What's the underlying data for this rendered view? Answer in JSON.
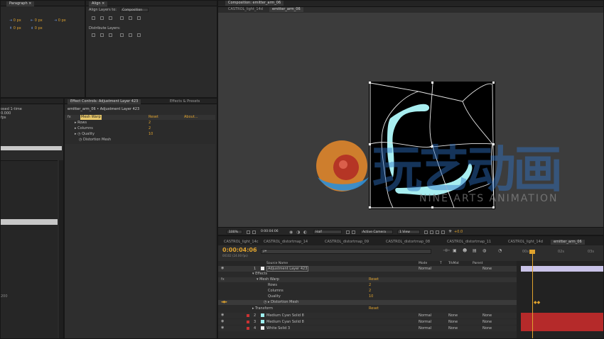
{
  "top_panels": {
    "paragraph_tab": "Paragraph ×",
    "align_tab": "Align ×",
    "align_layers_to_label": "Align Layers to:",
    "align_layers_to_value": "Composition",
    "distribute_layers_label": "Distribute Layers:",
    "paragraph_values": [
      "0 px",
      "0 px",
      "0 px",
      "0 px",
      "0 px"
    ]
  },
  "composition_panel": {
    "title": "Composition: emitter_arm_06",
    "tabs": [
      "CASTROL_light_14d",
      "emitter_arm_06"
    ],
    "footer": {
      "zoom": "100%",
      "timecode": "0:00:04:06",
      "resolution": "Half",
      "camera": "Active Camera",
      "views": "1 View",
      "exposure": "+0.0"
    }
  },
  "left_panel": {
    "info_lines": [
      "osed 1-time",
      "0.000",
      "fps"
    ],
    "bottom_value": "200"
  },
  "effect_controls": {
    "tab_label": "Effect Controls: Adjustment Layer 423",
    "tab2_label": "Effects & Presets",
    "breadcrumb": "emitter_arm_06 • Adjustment Layer 423",
    "effect_name": "Mesh Warp",
    "reset": "Reset",
    "about": "About...",
    "props": [
      {
        "name": "Rows",
        "value": "2"
      },
      {
        "name": "Columns",
        "value": "2"
      },
      {
        "name": "Quality",
        "value": "10"
      },
      {
        "name": "Distortion Mesh",
        "value": ""
      }
    ]
  },
  "timeline": {
    "tabs": [
      "CASTROL_light_14c",
      "CASTROL_distortmap_14",
      "CASTROL_distortmap_09",
      "CASTROL_distortmap_08",
      "CASTROL_distortmap_11",
      "CASTROL_light_14d",
      "emitter_arm_06"
    ],
    "timecode": "0:00:04:06",
    "fps_info": "00102 (24.00 fps)",
    "search_placeholder": "ρ▾",
    "columns": {
      "source_name": "Source Name",
      "mode": "Mode",
      "t": "T",
      "trkmat": "TrkMat",
      "parent": "Parent"
    },
    "ruler": [
      "00s",
      "02s",
      "03s",
      "04s"
    ],
    "layers": [
      {
        "num": "1",
        "name": "Adjustment Layer 423",
        "mode": "Normal",
        "trkmat": "",
        "parent": "None",
        "swatch": "white"
      },
      {
        "num": "2",
        "name": "Medium Cyan Solid 8",
        "mode": "Normal",
        "trkmat": "None",
        "parent": "None",
        "swatch": "cyan"
      },
      {
        "num": "3",
        "name": "Medium Cyan Solid 8",
        "mode": "Normal",
        "trkmat": "None",
        "parent": "None",
        "swatch": "cyan"
      },
      {
        "num": "4",
        "name": "White Solid 3",
        "mode": "Normal",
        "trkmat": "None",
        "parent": "None",
        "swatch": "white"
      }
    ],
    "sub_rows": [
      {
        "label": "Effects",
        "value": ""
      },
      {
        "label": "Mesh Warp",
        "value": "Reset"
      },
      {
        "label": "Rows",
        "value": "2"
      },
      {
        "label": "Columns",
        "value": "2"
      },
      {
        "label": "Quality",
        "value": "10"
      },
      {
        "label": "Distortion Mesh",
        "value": ""
      },
      {
        "label": "Transform",
        "value": "Reset"
      }
    ]
  },
  "watermark": {
    "cn_text": "玩艺动画",
    "en_text": "NINE ARTS ANIMATION"
  },
  "colors": {
    "accent_orange": "#e0a32e",
    "cyan_solid": "#9ff0f0",
    "track_red": "#b52a2a",
    "track_lavender": "#c9c3e8"
  }
}
